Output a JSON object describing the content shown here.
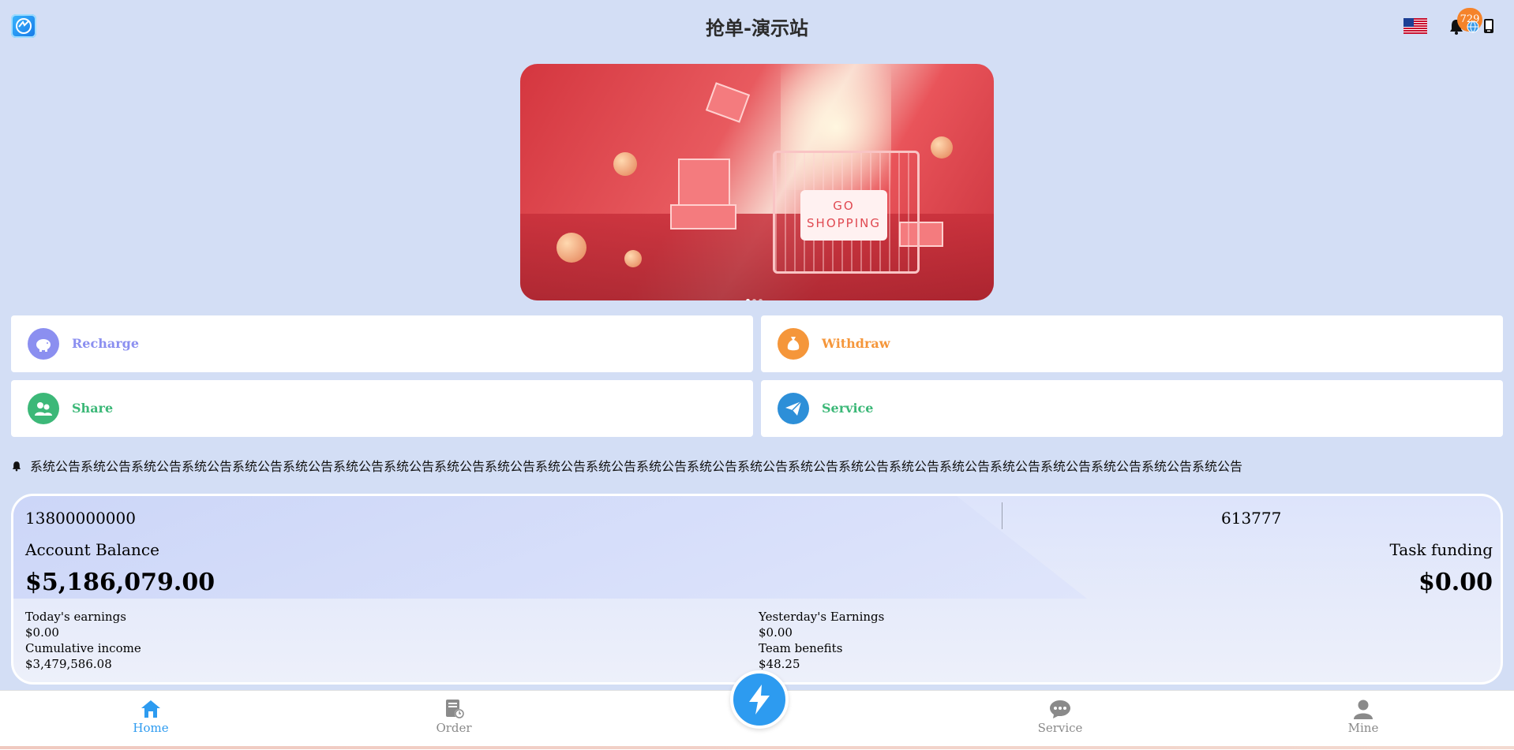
{
  "header": {
    "title": "抢单-演示站",
    "notification_count": "729",
    "icons": [
      "app-logo-icon",
      "us-flag-icon",
      "bell-icon",
      "globe-icon",
      "phone-icon"
    ]
  },
  "banner": {
    "sign_line1": "GO",
    "sign_line2": "SHOPPING",
    "slides": 3,
    "active_slide": 1
  },
  "actions": {
    "recharge": {
      "label": "Recharge",
      "color": "#8b8ff0",
      "icon": "piggy-bank-icon"
    },
    "withdraw": {
      "label": "Withdraw",
      "color": "#f5963a",
      "icon": "money-bag-icon"
    },
    "share": {
      "label": "Share",
      "color": "#3cb878",
      "icon": "users-icon"
    },
    "service": {
      "label": "Service",
      "color": "#3cb878",
      "icon": "paper-plane-icon",
      "circle_color": "#2d8fd8"
    }
  },
  "notice": {
    "icon": "bell-icon",
    "text": "系统公告系统公告系统公告系统公告系统公告系统公告系统公告系统公告系统公告系统公告系统公告系统公告系统公告系统公告系统公告系统公告系统公告系统公告系统公告系统公告系统公告系统公告系统公告系统公告"
  },
  "account": {
    "phone": "13800000000",
    "code": "613777",
    "balance_label": "Account Balance",
    "balance": "$5,186,079.00",
    "task_label": "Task funding",
    "task_value": "$0.00",
    "stats": {
      "today_label": "Today's earnings",
      "today_value": "$0.00",
      "cumulative_label": "Cumulative income",
      "cumulative_value": "$3,479,586.08",
      "yesterday_label": "Yesterday's Earnings",
      "yesterday_value": "$0.00",
      "team_label": "Team benefits",
      "team_value": "$48.25"
    }
  },
  "nav": {
    "home": "Home",
    "order": "Order",
    "service": "Service",
    "mine": "Mine",
    "active": "home",
    "active_color": "#2d9bf0",
    "inactive_color": "#8a8a8a"
  }
}
